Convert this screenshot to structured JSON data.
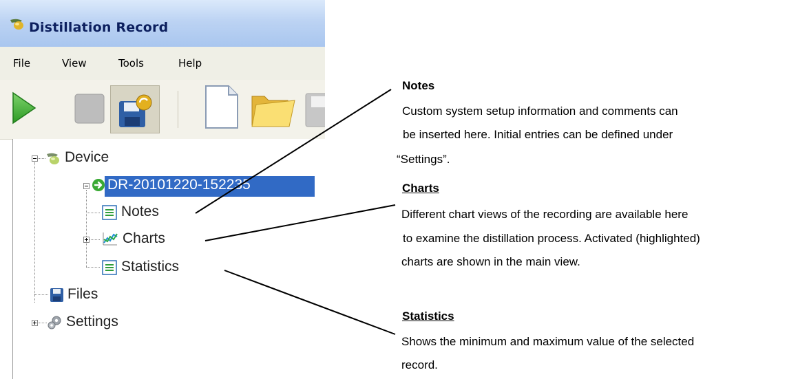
{
  "window": {
    "title": "Distillation Record"
  },
  "menu": {
    "items": [
      "File",
      "View",
      "Tools",
      "Help"
    ]
  },
  "toolbar": {
    "buttons": [
      "play-icon",
      "stop-icon",
      "save-record-icon",
      "new-document-icon",
      "open-folder-icon",
      "save-icon"
    ]
  },
  "tree": {
    "device": "Device",
    "record": "DR-20101220-152235",
    "notes": "Notes",
    "charts": "Charts",
    "statistics": "Statistics",
    "files": "Files",
    "settings": "Settings"
  },
  "annotations": {
    "notes": {
      "title": "Notes",
      "lines": [
        "Custom system setup information and comments can",
        "be inserted here. Initial entries can be defined under",
        "“Settings”."
      ]
    },
    "charts": {
      "title": "Charts",
      "lines": [
        "Different chart views of the recording are available here",
        "to examine the distillation process. Activated (highlighted)",
        "charts  are shown in the main view."
      ]
    },
    "statistics": {
      "title": "Statistics",
      "lines": [
        "Shows the minimum and maximum value of the selected",
        "record."
      ]
    }
  },
  "colors": {
    "selection": "#316ac5",
    "title_text": "#0c1f5e"
  }
}
